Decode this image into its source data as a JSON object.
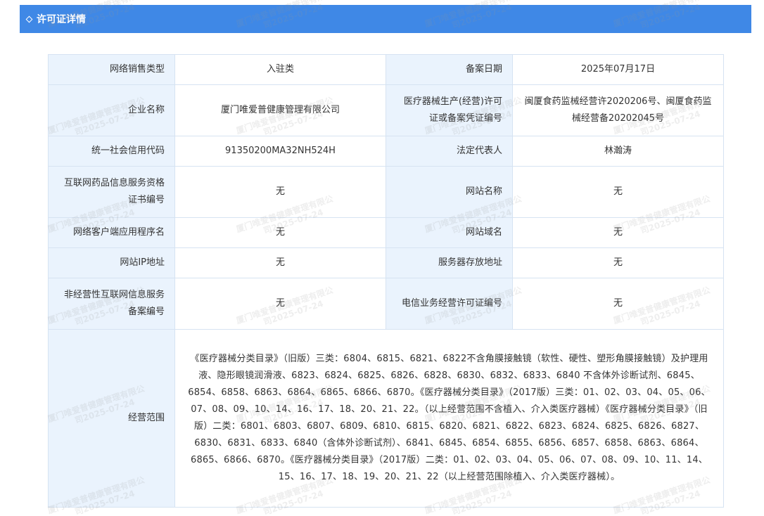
{
  "header": {
    "title": "许可证详情"
  },
  "rows": [
    {
      "label1": "网络销售类型",
      "value1": "入驻类",
      "label2": "备案日期",
      "value2": "2025年07月17日"
    },
    {
      "label1": "企业名称",
      "value1": "厦门唯爱普健康管理有限公司",
      "label2": "医疗器械生产(经营)许可证或备案凭证编号",
      "value2": "闽厦食药监械经营许2020206号、闽厦食药监械经营备20202045号"
    },
    {
      "label1": "统一社会信用代码",
      "value1": "91350200MA32NH524H",
      "label2": "法定代表人",
      "value2": "林瀚涛"
    },
    {
      "label1": "互联网药品信息服务资格证书编号",
      "value1": "无",
      "label2": "网站名称",
      "value2": "无"
    },
    {
      "label1": "网络客户端应用程序名",
      "value1": "无",
      "label2": "网站域名",
      "value2": "无"
    },
    {
      "label1": "网站IP地址",
      "value1": "无",
      "label2": "服务器存放地址",
      "value2": "无"
    },
    {
      "label1": "非经营性互联网信息服务备案编号",
      "value1": "无",
      "label2": "电信业务经营许可证编号",
      "value2": "无"
    }
  ],
  "scope": {
    "label": "经营范围",
    "value": "《医疗器械分类目录》（旧版）三类：6804、6815、6821、6822不含角膜接触镜（软性、硬性、塑形角膜接触镜）及护理用液、隐形眼镜润滑液、6823、6824、6825、6826、6828、6830、6832、6833、6840 不含体外诊断试剂、6845、6854、6858、6863、6864、6865、6866、6870。《医疗器械分类目录》（2017版）三类：01、02、03、04、05、06、07、08、09、10、14、16、17、18、20、21、22。（以上经营范围不含植入、介入类医疗器械）《医疗器械分类目录》（旧版）二类：6801、6803、6807、6809、6810、6815、6820、6821、6822、6823、6824、6825、6826、6827、6830、6831、6833、6840（含体外诊断试剂）、6841、6845、6854、6855、6856、6857、6858、6863、6864、6865、6866、6870。《医疗器械分类目录》（2017版）二类：01、02、03、04、05、06、07、08、09、10、11、14、15、16、17、18、19、20、21、22（以上经营范围除植入、介入类医疗器械）。"
  },
  "watermark": {
    "line1": "厦门唯爱普健康管理有限公",
    "line2": "司2025-07-24"
  }
}
